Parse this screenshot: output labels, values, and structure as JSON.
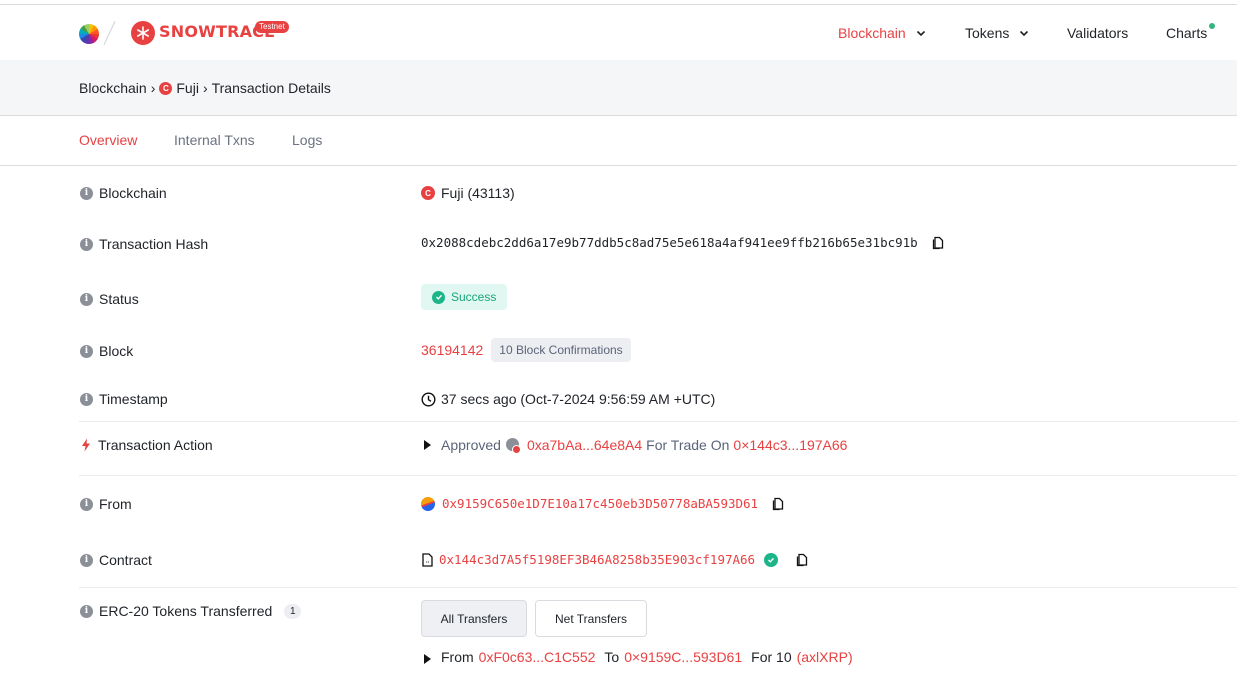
{
  "header": {
    "brand": "SNOWTRACE",
    "brand_badge": "Testnet",
    "nav": [
      {
        "label": "Blockchain",
        "active": true,
        "dropdown": true
      },
      {
        "label": "Tokens",
        "active": false,
        "dropdown": true
      },
      {
        "label": "Validators",
        "active": false,
        "dropdown": false
      },
      {
        "label": "Charts",
        "active": false,
        "dropdown": false,
        "indicator": true
      }
    ]
  },
  "breadcrumb": {
    "items": [
      "Blockchain",
      "Fuji",
      "Transaction Details"
    ],
    "separator": "›",
    "chain_badge": "C"
  },
  "tabs": [
    {
      "label": "Overview",
      "active": true
    },
    {
      "label": "Internal Txns",
      "active": false
    },
    {
      "label": "Logs",
      "active": false
    }
  ],
  "details": {
    "blockchain": {
      "label": "Blockchain",
      "value": "Fuji (43113)",
      "badge": "C"
    },
    "tx_hash": {
      "label": "Transaction Hash",
      "value": "0x2088cdebc2dd6a17e9b77ddb5c8ad75e5e618a4af941ee9ffb216b65e31bc91b"
    },
    "status": {
      "label": "Status",
      "value": "Success"
    },
    "block": {
      "label": "Block",
      "value": "36194142",
      "confirmations": "10 Block Confirmations"
    },
    "timestamp": {
      "label": "Timestamp",
      "value": "37 secs ago (Oct-7-2024 9:56:59 AM +UTC)"
    },
    "action": {
      "label": "Transaction Action",
      "verb": "Approved",
      "spender": "0xa7bAa...64e8A4",
      "middle": "For Trade On",
      "target": "0×144c3...197A66"
    },
    "from": {
      "label": "From",
      "value": "0x9159C650e1D7E10a17c450eb3D50778aBA593D61"
    },
    "contract": {
      "label": "Contract",
      "value": "0x144c3d7A5f5198EF3B46A8258b35E903cf197A66"
    },
    "erc20": {
      "label": "ERC-20 Tokens Transferred",
      "count": "1",
      "buttons": [
        "All Transfers",
        "Net Transfers"
      ],
      "transfer": {
        "from_label": "From",
        "from": "0xF0c63...C1C552",
        "to_label": "To",
        "to": "0×9159C...593D61",
        "for_label": "For 10",
        "token": "(axlXRP)"
      }
    }
  },
  "colors": {
    "accent": "#e84142",
    "success": "#1cb589",
    "success_bg": "#e1f7f1",
    "muted": "#5b6478"
  }
}
